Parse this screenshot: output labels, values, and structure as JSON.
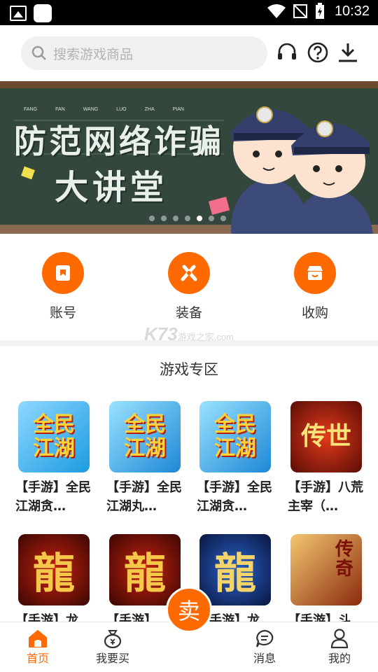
{
  "status_bar": {
    "time": "10:32"
  },
  "search": {
    "placeholder": "搜索游戏商品"
  },
  "banner": {
    "headline": "防范网络诈骗",
    "subline": "大讲堂",
    "pinyin": [
      "FANG",
      "FAN",
      "WANG",
      "LUO",
      "ZHA",
      "PIAN"
    ],
    "slide_count": 7,
    "active_slide": 5
  },
  "categories": [
    {
      "label": "账号",
      "icon": "account-icon"
    },
    {
      "label": "装备",
      "icon": "equipment-icon"
    },
    {
      "label": "收购",
      "icon": "store-icon"
    }
  ],
  "watermark": {
    "brand": "K73",
    "tag": "游戏之家",
    "domain": ".com"
  },
  "section": {
    "title": "游戏专区"
  },
  "games": [
    {
      "title": "【手游】全民江湖贪…",
      "art": "全民江湖"
    },
    {
      "title": "【手游】全民江湖丸…",
      "art": "全民江湖"
    },
    {
      "title": "【手游】全民江湖贪…",
      "art": "全民江湖"
    },
    {
      "title": "【手游】八荒主宰（…",
      "art": "传世"
    },
    {
      "title": "【手游】龙",
      "art": "龍"
    },
    {
      "title": "【手游】",
      "art": "龍"
    },
    {
      "title": "【手游】龙",
      "art": "龍"
    },
    {
      "title": "【手游】斗",
      "art": "传奇"
    }
  ],
  "bottom_nav": {
    "home": "首页",
    "buy": "我要买",
    "sell": "卖",
    "messages": "消息",
    "mine": "我的"
  },
  "colors": {
    "accent": "#ff6a00"
  }
}
